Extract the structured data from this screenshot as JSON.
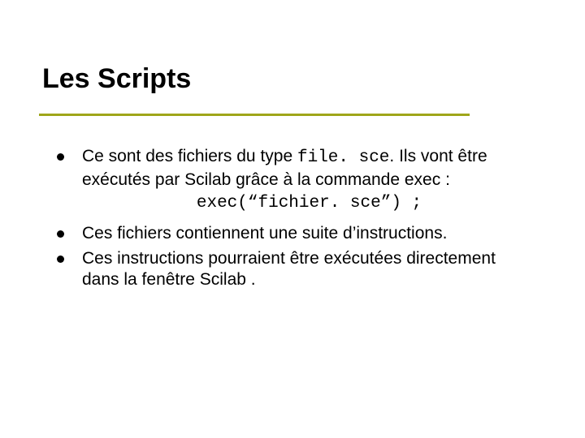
{
  "title": "Les Scripts",
  "bullet1": {
    "pre": "Ce sont des fichiers du type ",
    "code": "file. sce",
    "post": ". Ils vont être exécutés par Scilab grâce à la commande exec :",
    "codeline": "exec(“fichier. sce”) ;"
  },
  "bullet2": "Ces fichiers contiennent une suite d’instructions.",
  "bullet3": "Ces instructions pourraient être exécutées directement dans la fenêtre Scilab ."
}
